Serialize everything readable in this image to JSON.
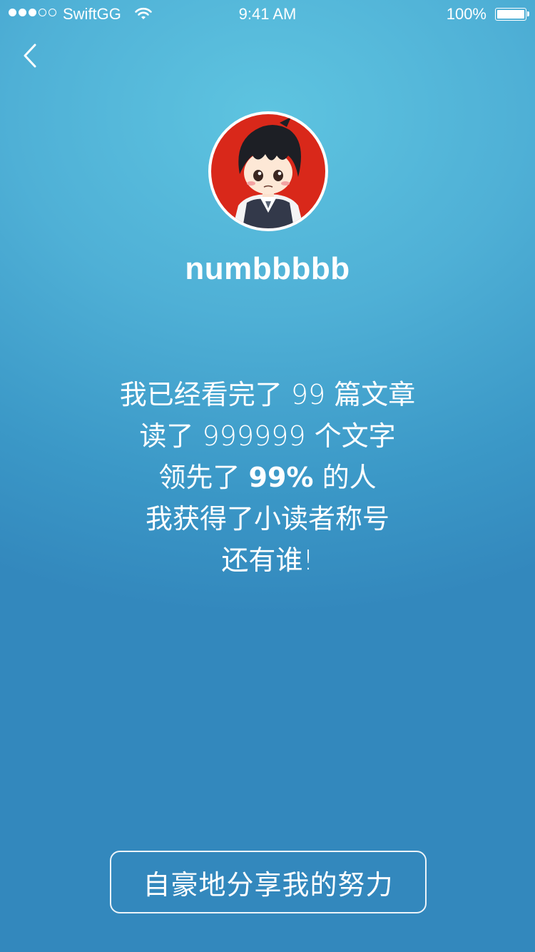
{
  "status_bar": {
    "carrier": "SwiftGG",
    "time": "9:41 AM",
    "battery": "100%",
    "signal_bars": 3,
    "signal_total": 5,
    "battery_level": 1.0
  },
  "nav": {
    "back_icon": "chevron-left-icon"
  },
  "profile": {
    "avatar_icon": "avatar-anime-boy",
    "avatar_bg_color": "#d9281a",
    "username": "numbbbbb"
  },
  "stats": {
    "line1_pre": "我已经看完了 ",
    "articles": "99",
    "line1_post": " 篇文章",
    "line2_pre": "读了 ",
    "words": "999999",
    "line2_post": " 个文字",
    "line3_pre": "领先了 ",
    "percent": "99%",
    "line3_post": " 的人",
    "line4": "我获得了小读者称号",
    "line5": "还有谁!"
  },
  "share_button": {
    "label": "自豪地分享我的努力"
  },
  "colors": {
    "bg_top": "#5ec4e0",
    "bg_bottom": "#3388bd",
    "text": "#ffffff"
  }
}
